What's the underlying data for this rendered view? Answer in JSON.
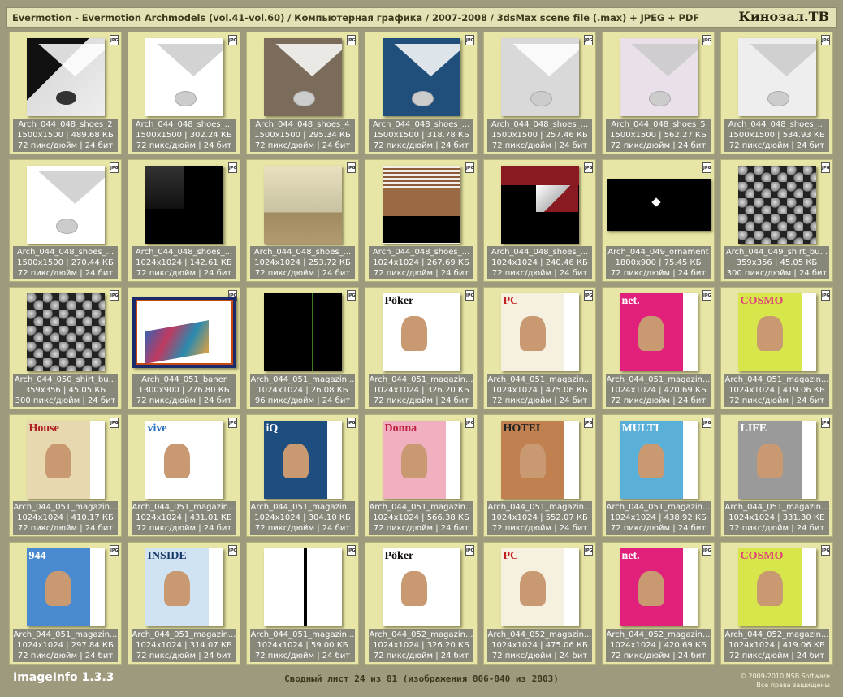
{
  "header": {
    "title": "Evermotion - Evermotion Archmodels (vol.41-vol.60) / Компьютерная графика / 2007-2008 / 3dsMax scene file (.max) + JPEG + PDF",
    "brand": "Кинозал.ТВ"
  },
  "badge_label": "JPG",
  "colors": {
    "background": "#9e9a7d",
    "cell": "#e8e6a6",
    "info": "#88887a",
    "header": "#e3e1b6"
  },
  "items": [
    {
      "name": "Arch_044_048_shoes_2",
      "dims": "1500x1500 | 489.68 КБ",
      "meta": "72 пикс/дюйм | 24 бит",
      "art": "shoe-a"
    },
    {
      "name": "Arch_044_048_shoes_...",
      "dims": "1500x1500 | 302.24 КБ",
      "meta": "72 пикс/дюйм | 24 бит",
      "art": "shoe-b"
    },
    {
      "name": "Arch_044_048_shoes_4",
      "dims": "1500x1500 | 295.34 КБ",
      "meta": "72 пикс/дюйм | 24 бит",
      "art": "shoe-c"
    },
    {
      "name": "Arch_044_048_shoes_...",
      "dims": "1500x1500 | 318.78 КБ",
      "meta": "72 пикс/дюйм | 24 бит",
      "art": "shoe-d"
    },
    {
      "name": "Arch_044_048_shoes_...",
      "dims": "1500x1500 | 257.46 КБ",
      "meta": "72 пикс/дюйм | 24 бит",
      "art": "shoe-e"
    },
    {
      "name": "Arch_044_048_shoes_5",
      "dims": "1500x1500 | 562.27 КБ",
      "meta": "72 пикс/дюйм | 24 бит",
      "art": "shoe-f"
    },
    {
      "name": "Arch_044_048_shoes_...",
      "dims": "1500x1500 | 534.93 КБ",
      "meta": "72 пикс/дюйм | 24 бит",
      "art": "shoe-g"
    },
    {
      "name": "Arch_044_048_shoes_...",
      "dims": "1500x1500 | 270.44 КБ",
      "meta": "72 пикс/дюйм | 24 бит",
      "art": "shoe-b"
    },
    {
      "name": "Arch_044_048_shoes_...",
      "dims": "1024x1024 | 142.61 КБ",
      "meta": "72 пикс/дюйм | 24 бит",
      "art": "ever"
    },
    {
      "name": "Arch_044_048_shoes_...",
      "dims": "1024x1024 | 253.72 КБ",
      "meta": "72 пикс/дюйм | 24 бит",
      "art": "runners"
    },
    {
      "name": "Arch_044_048_shoes_...",
      "dims": "1024x1024 | 267.69 КБ",
      "meta": "72 пикс/дюйм | 24 бит",
      "art": "brown"
    },
    {
      "name": "Arch_044_048_shoes_...",
      "dims": "1024x1024 | 240.46 КБ",
      "meta": "72 пикс/дюйм | 24 бит",
      "art": "mountain"
    },
    {
      "name": "Arch_044_049_ornament",
      "dims": "1800x900 | 75.45 КБ",
      "meta": "72 пикс/дюйм | 24 бит",
      "art": "ornament"
    },
    {
      "name": "Arch_044_049_shirt_bu...",
      "dims": "359x356 | 45.05 КБ",
      "meta": "300 пикс/дюйм | 24 бит",
      "art": "weave"
    },
    {
      "name": "Arch_044_050_shirt_bu...",
      "dims": "359x356 | 45.05 КБ",
      "meta": "300 пикс/дюйм | 24 бит",
      "art": "weave"
    },
    {
      "name": "Arch_044_051_baner",
      "dims": "1300x900 | 276.80 КБ",
      "meta": "72 пикс/дюйм | 24 бит",
      "art": "banner"
    },
    {
      "name": "Arch_044_051_magazin...",
      "dims": "1024x1024 | 26.08 КБ",
      "meta": "96 пикс/дюйм | 24 бит",
      "art": "black"
    },
    {
      "name": "Arch_044_051_magazin...",
      "dims": "1024x1024 | 326.20 КБ",
      "meta": "72 пикс/дюйм | 24 бит",
      "art": "mag",
      "cover": "Pöker",
      "c1": "#ffffff",
      "c2": "#111111"
    },
    {
      "name": "Arch_044_051_magazin...",
      "dims": "1024x1024 | 475.06 КБ",
      "meta": "72 пикс/дюйм | 24 бит",
      "art": "mag",
      "cover": "PC",
      "c1": "#f5f0e0",
      "c2": "#c02020"
    },
    {
      "name": "Arch_044_051_magazin...",
      "dims": "1024x1024 | 420.69 КБ",
      "meta": "72 пикс/дюйм | 24 бит",
      "art": "mag",
      "cover": "net.",
      "c1": "#e0207a",
      "c2": "#ffffff"
    },
    {
      "name": "Arch_044_051_magazin...",
      "dims": "1024x1024 | 419.06 КБ",
      "meta": "72 пикс/дюйм | 24 бит",
      "art": "mag",
      "cover": "COSMO",
      "c1": "#d7e64a",
      "c2": "#e0407a"
    },
    {
      "name": "Arch_044_051_magazin...",
      "dims": "1024x1024 | 410.17 КБ",
      "meta": "72 пикс/дюйм | 24 бит",
      "art": "mag",
      "cover": "House",
      "c1": "#e8d8b0",
      "c2": "#b02020"
    },
    {
      "name": "Arch_044_051_magazin...",
      "dims": "1024x1024 | 431.01 КБ",
      "meta": "72 пикс/дюйм | 24 бит",
      "art": "mag",
      "cover": "vive",
      "c1": "#ffffff",
      "c2": "#2a6fc0"
    },
    {
      "name": "Arch_044_051_magazin...",
      "dims": "1024x1024 | 304.10 КБ",
      "meta": "72 пикс/дюйм | 24 бит",
      "art": "mag",
      "cover": "iQ",
      "c1": "#1e4d80",
      "c2": "#ffffff"
    },
    {
      "name": "Arch_044_051_magazin...",
      "dims": "1024x1024 | 566.38 КБ",
      "meta": "72 пикс/дюйм | 24 бит",
      "art": "mag",
      "cover": "Donna",
      "c1": "#f0b0c0",
      "c2": "#c02040"
    },
    {
      "name": "Arch_044_051_magazin...",
      "dims": "1024x1024 | 552.07 КБ",
      "meta": "72 пикс/дюйм | 24 бит",
      "art": "mag",
      "cover": "HOTEL",
      "c1": "#c08050",
      "c2": "#222222"
    },
    {
      "name": "Arch_044_051_magazin...",
      "dims": "1024x1024 | 438.92 КБ",
      "meta": "72 пикс/дюйм | 24 бит",
      "art": "mag",
      "cover": "MULTI",
      "c1": "#5ab0d8",
      "c2": "#ffffff"
    },
    {
      "name": "Arch_044_051_magazin...",
      "dims": "1024x1024 | 331.30 КБ",
      "meta": "72 пикс/дюйм | 24 бит",
      "art": "mag",
      "cover": "LIFE",
      "c1": "#9a9a9a",
      "c2": "#ffffff"
    },
    {
      "name": "Arch_044_051_magazin...",
      "dims": "1024x1024 | 297.84 КБ",
      "meta": "72 пикс/дюйм | 24 бит",
      "art": "mag",
      "cover": "944",
      "c1": "#4a8ad0",
      "c2": "#ffffff"
    },
    {
      "name": "Arch_044_051_magazin...",
      "dims": "1024x1024 | 314.07 КБ",
      "meta": "72 пикс/дюйм | 24 бит",
      "art": "mag",
      "cover": "INSIDE",
      "c1": "#cfe3f2",
      "c2": "#1a3a6a"
    },
    {
      "name": "Arch_044_051_magazin...",
      "dims": "1024x1024 | 59.00 КБ",
      "meta": "72 пикс/дюйм | 24 бит",
      "art": "stripe"
    },
    {
      "name": "Arch_044_052_magazin...",
      "dims": "1024x1024 | 326.20 КБ",
      "meta": "72 пикс/дюйм | 24 бит",
      "art": "mag",
      "cover": "Pöker",
      "c1": "#ffffff",
      "c2": "#111111"
    },
    {
      "name": "Arch_044_052_magazin...",
      "dims": "1024x1024 | 475.06 КБ",
      "meta": "72 пикс/дюйм | 24 бит",
      "art": "mag",
      "cover": "PC",
      "c1": "#f5f0e0",
      "c2": "#c02020"
    },
    {
      "name": "Arch_044_052_magazin...",
      "dims": "1024x1024 | 420.69 КБ",
      "meta": "72 пикс/дюйм | 24 бит",
      "art": "mag",
      "cover": "net.",
      "c1": "#e0207a",
      "c2": "#ffffff"
    },
    {
      "name": "Arch_044_052_magazin...",
      "dims": "1024x1024 | 419.06 КБ",
      "meta": "72 пикс/дюйм | 24 бит",
      "art": "mag",
      "cover": "COSMO",
      "c1": "#d7e64a",
      "c2": "#e0407a"
    }
  ],
  "footer": {
    "app": "ImageInfo 1.3.3",
    "sheet": "Сводный лист 24 из 81 (изображения 806-840 из 2803)",
    "copyright": "© 2009-2010 NSB Software",
    "rights": "Все права защищены"
  }
}
